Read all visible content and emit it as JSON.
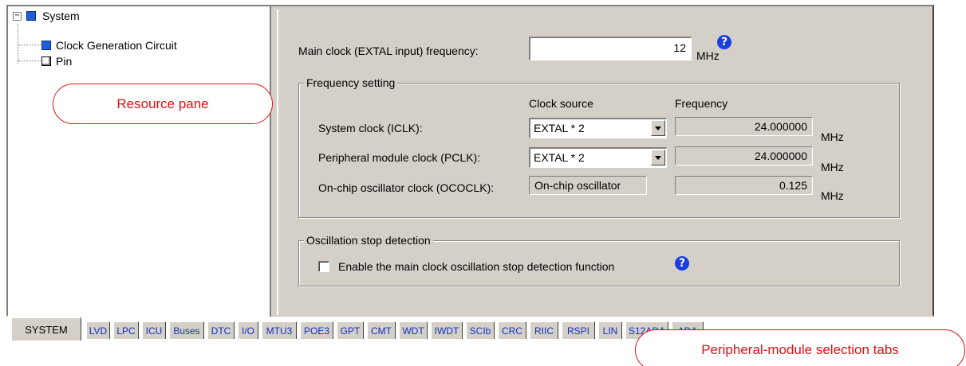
{
  "tree": {
    "root": "System",
    "children": [
      "Clock Generation Circuit",
      "Pin"
    ]
  },
  "callouts": {
    "resource_pane": "Resource pane",
    "tabs": "Peripheral-module selection tabs"
  },
  "settings": {
    "main_clock_label": "Main clock (EXTAL input) frequency:",
    "main_clock_value": "12",
    "main_clock_unit": "MHz",
    "freq_group_title": "Frequency setting",
    "col_clock_source": "Clock source",
    "col_frequency": "Frequency",
    "rows": [
      {
        "label": "System clock (ICLK):",
        "source": "EXTAL * 2",
        "freq": "24.000000",
        "unit": "MHz"
      },
      {
        "label": "Peripheral module clock (PCLK):",
        "source": "EXTAL * 2",
        "freq": "24.000000",
        "unit": "MHz"
      },
      {
        "label": "On-chip oscillator clock (OCOCLK):",
        "source": "On-chip oscillator",
        "freq": "0.125",
        "unit": "MHz"
      }
    ],
    "osc_group_title": "Oscillation stop detection",
    "osc_check_label": "Enable the main clock oscillation stop detection function",
    "help_glyph": "?"
  },
  "tabs": [
    "SYSTEM",
    "LVD",
    "LPC",
    "ICU",
    "Buses",
    "DTC",
    "I/O",
    "MTU3",
    "POE3",
    "GPT",
    "CMT",
    "WDT",
    "IWDT",
    "SCIb",
    "CRC",
    "RIIC",
    "RSPI",
    "LIN",
    "S12ADA",
    "ADA"
  ],
  "colors": {
    "accent": "#1a3fe0",
    "callout": "#e01010",
    "panel": "#d4d0c8"
  }
}
